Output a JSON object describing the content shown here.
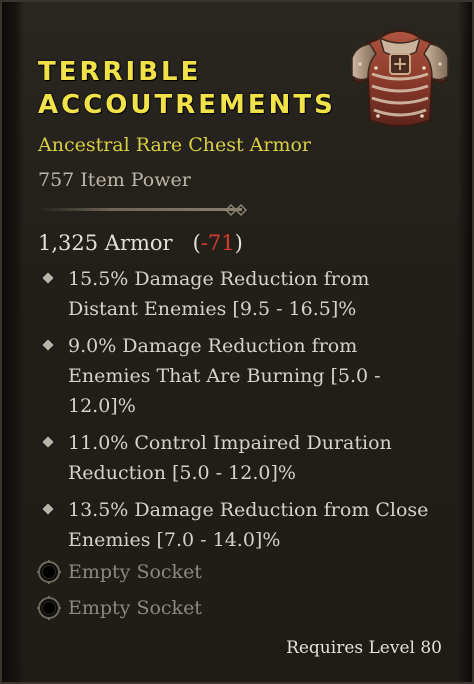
{
  "item": {
    "name_line1": "TERRIBLE",
    "name_line2": "ACCOUTREMENTS",
    "subtitle": "Ancestral Rare Chest Armor",
    "item_power": "757 Item Power",
    "armor_value": "1,325 Armor",
    "armor_diff": "-71",
    "icon": "chest-armor-icon"
  },
  "affixes": [
    {
      "line1": "15.5% Damage Reduction from",
      "line2": "Distant Enemies [9.5 - 16.5]%",
      "line3": ""
    },
    {
      "line1": "9.0% Damage Reduction from",
      "line2": "Enemies That Are Burning [5.0 -",
      "line3": "12.0]%"
    },
    {
      "line1": "11.0% Control Impaired Duration",
      "line2": "Reduction [5.0 - 12.0]%",
      "line3": ""
    },
    {
      "line1": "13.5% Damage Reduction from Close",
      "line2": "Enemies [7.0 - 14.0]%",
      "line3": ""
    }
  ],
  "sockets": [
    {
      "label": "Empty Socket"
    },
    {
      "label": "Empty Socket"
    }
  ],
  "requirement": "Requires Level 80",
  "colors": {
    "name": "#f2e24a",
    "subtitle": "#d9cf45",
    "negative_diff": "#d63a2d",
    "body_text": "#d7d2c8",
    "socket_text": "#8c8780"
  }
}
